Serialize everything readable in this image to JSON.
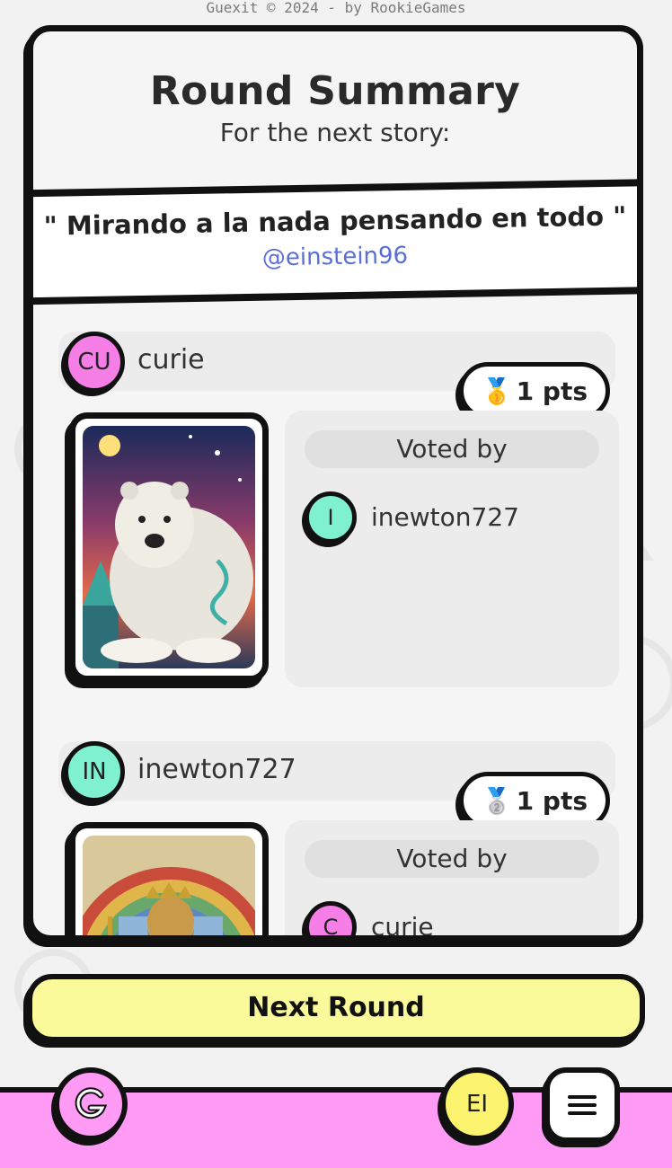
{
  "footer_top": {
    "copyright": "Guexit © 2024 - by RookieGames"
  },
  "summary": {
    "title": "Round Summary",
    "subtitle": "For the next story:",
    "story": "\" Mirando a la nada pensando en todo \"",
    "author": "@einstein96"
  },
  "entries": [
    {
      "player_initials": "CU",
      "player_name": "curie",
      "avatar_color": "#f57fe6",
      "medal": "🥇",
      "points": "1 pts",
      "card_image": "polar-bear-artwork",
      "voted_by_label": "Voted by",
      "voters": [
        {
          "initials": "I",
          "name": "inewton727",
          "color": "#7ff0d0"
        }
      ]
    },
    {
      "player_initials": "IN",
      "player_name": "inewton727",
      "avatar_color": "#7ff0d0",
      "medal": "🥈",
      "points": "1 pts",
      "card_image": "bearded-god-artwork",
      "voted_by_label": "Voted by",
      "voters": [
        {
          "initials": "C",
          "name": "curie",
          "color": "#f57fe6"
        }
      ]
    }
  ],
  "actions": {
    "next_round": "Next Round"
  },
  "nav": {
    "logo_icon": "guexit-logo-icon",
    "me_initials": "EI",
    "me_color": "#fcf36e",
    "menu_icon": "hamburger-menu-icon"
  },
  "colors": {
    "accent_pink": "#ff9af5",
    "accent_yellow": "#fafa9a",
    "link_blue": "#5a6fd6"
  }
}
